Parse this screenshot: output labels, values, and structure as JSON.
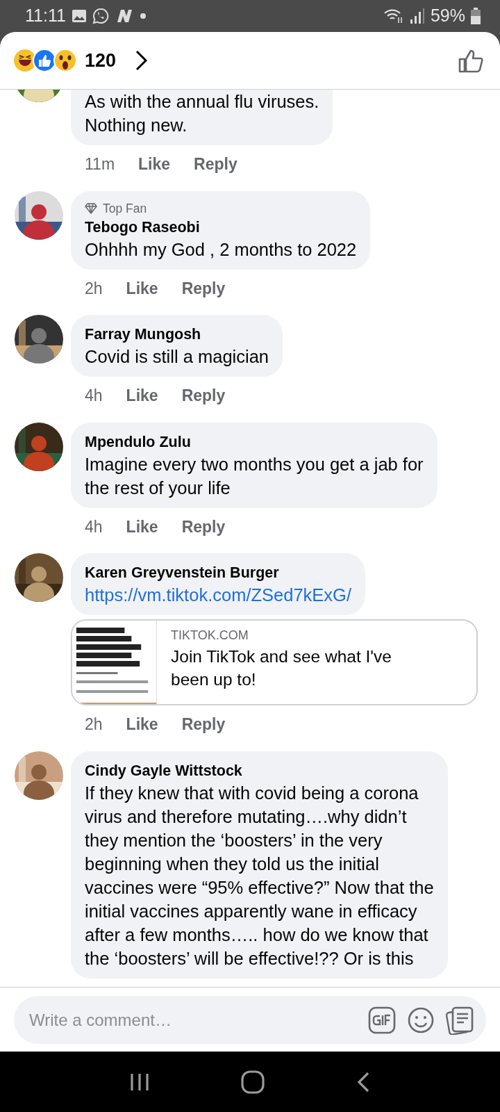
{
  "status_bar": {
    "time": "11:11",
    "battery": "59%"
  },
  "header": {
    "reaction_count": "120"
  },
  "comments": [
    {
      "kind": "text",
      "text": "As with the annual flu viruses.\nNothing new.",
      "time": "11m",
      "like": "Like",
      "reply": "Reply"
    },
    {
      "kind": "text",
      "badge": "Top Fan",
      "author": "Tebogo Raseobi",
      "text": "Ohhhh my God , 2 months to 2022",
      "time": "2h",
      "like": "Like",
      "reply": "Reply"
    },
    {
      "kind": "text",
      "author": "Farray Mungosh",
      "text": "Covid is still a magician",
      "time": "4h",
      "like": "Like",
      "reply": "Reply"
    },
    {
      "kind": "text",
      "author": "Mpendulo Zulu",
      "text": "Imagine every two months you get a jab for\nthe rest of your life",
      "time": "4h",
      "like": "Like",
      "reply": "Reply"
    },
    {
      "kind": "link",
      "author": "Karen Greyvenstein Burger",
      "text": "https://vm.tiktok.com/ZSed7kExG/",
      "preview": {
        "domain": "TIKTOK.COM",
        "title": "Join TikTok and see what I've\nbeen up to!"
      },
      "time": "2h",
      "like": "Like",
      "reply": "Reply"
    },
    {
      "kind": "text",
      "author": "Cindy Gayle Wittstock",
      "text": "If they knew that with covid being a corona\nvirus and therefore mutating….why didn’t\nthey mention the ‘boosters’ in the very\nbeginning when they told us the initial\nvaccines were “95% effective?” Now that the\ninitial vaccines apparently wane in efficacy\nafter a few months….. how do we know that\nthe ‘boosters’ will be effective!?? Or is this"
    }
  ],
  "composer": {
    "placeholder": "Write a comment…"
  }
}
